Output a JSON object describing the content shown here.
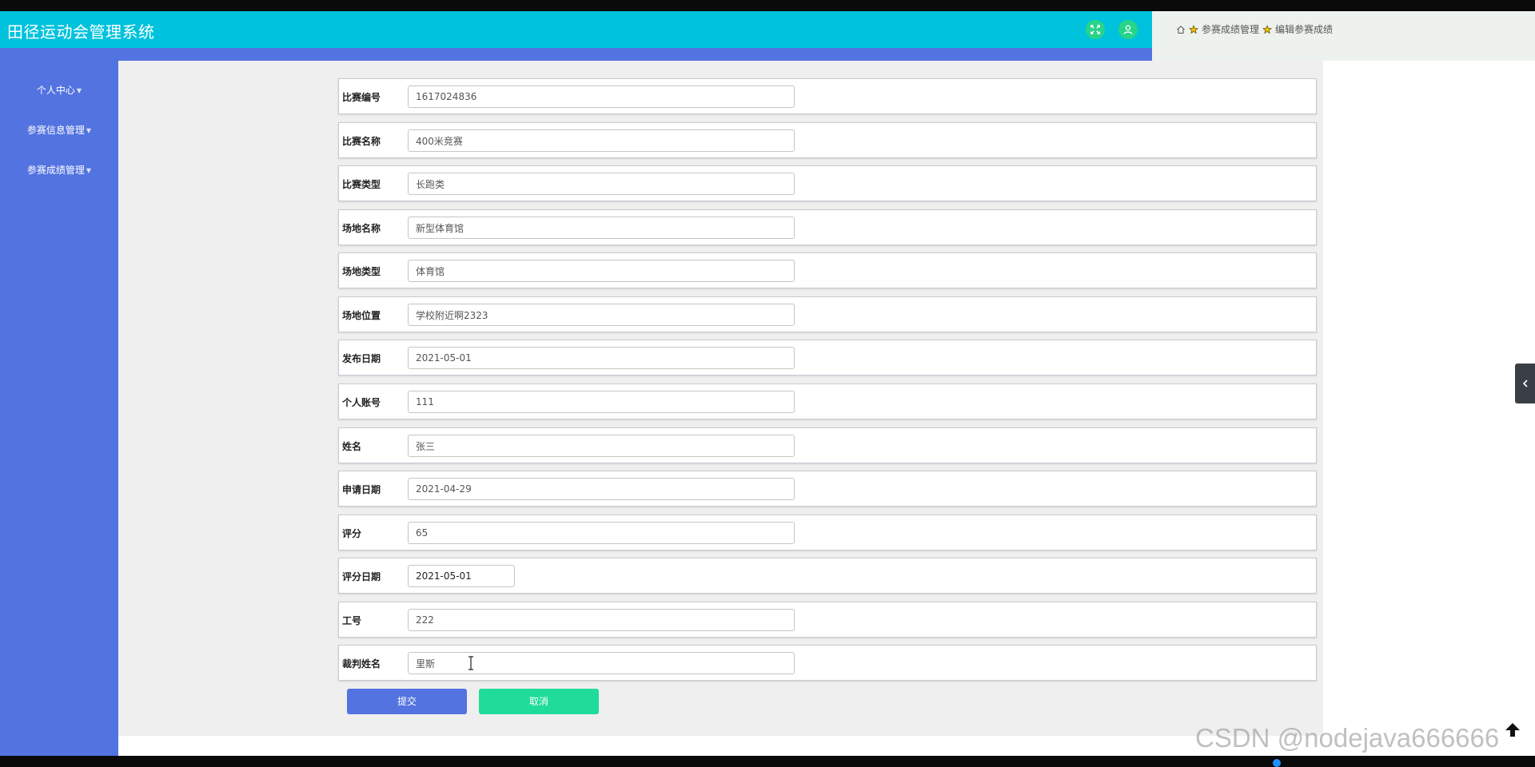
{
  "app": {
    "title": "田径运动会管理系统"
  },
  "header": {
    "fullscreen_icon": "fullscreen-icon",
    "user_icon": "user-icon"
  },
  "breadcrumb": {
    "home_icon": "home-icon",
    "items": [
      "参赛成绩管理",
      "编辑参赛成绩"
    ]
  },
  "sidebar": {
    "items": [
      {
        "label": "个人中心"
      },
      {
        "label": "参赛信息管理"
      },
      {
        "label": "参赛成绩管理"
      }
    ]
  },
  "form": {
    "fields": [
      {
        "label": "比赛编号",
        "value": "1617024836"
      },
      {
        "label": "比赛名称",
        "value": "400米竞赛"
      },
      {
        "label": "比赛类型",
        "value": "长跑类"
      },
      {
        "label": "场地名称",
        "value": "新型体育馆"
      },
      {
        "label": "场地类型",
        "value": "体育馆"
      },
      {
        "label": "场地位置",
        "value": "学校附近啊2323"
      },
      {
        "label": "发布日期",
        "value": "2021-05-01"
      },
      {
        "label": "个人账号",
        "value": "111"
      },
      {
        "label": "姓名",
        "value": "张三"
      },
      {
        "label": "申请日期",
        "value": "2021-04-29"
      },
      {
        "label": "评分",
        "value": "65"
      },
      {
        "label": "评分日期",
        "value": "2021-05-01"
      },
      {
        "label": "工号",
        "value": "222"
      },
      {
        "label": "裁判姓名",
        "value": "里斯"
      }
    ],
    "submit_label": "提交",
    "cancel_label": "取消"
  },
  "watermark": "CSDN @nodejava666666",
  "colors": {
    "header": "#00c2dc",
    "sidebar": "#5373e0",
    "submit": "#5373e0",
    "cancel": "#1fdc9a"
  }
}
